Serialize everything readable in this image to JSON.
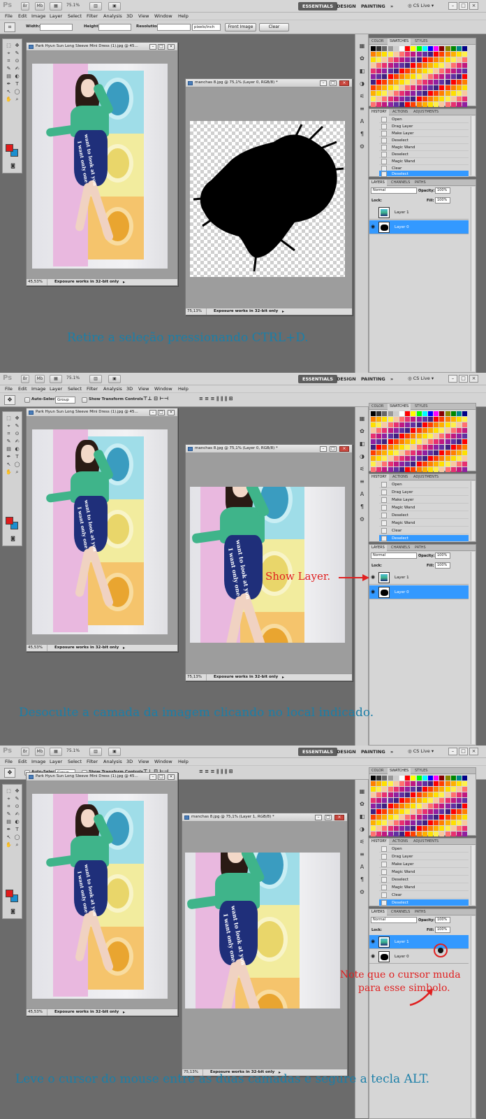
{
  "app": {
    "logo": "Ps",
    "mini_bridge_label": "Br",
    "mini_mb_label": "Mb",
    "zoom": "75.1%",
    "workspaces": [
      "ESSENTIALS",
      "DESIGN",
      "PAINTING",
      "»"
    ],
    "cs_live": "CS Live",
    "menu": [
      "File",
      "Edit",
      "Image",
      "Layer",
      "Select",
      "Filter",
      "Analysis",
      "3D",
      "View",
      "Window",
      "Help"
    ],
    "window_controls": [
      "–",
      "□",
      "×"
    ]
  },
  "options_crop": {
    "width_label": "Width:",
    "height_label": "Height:",
    "resolution_label": "Resolution:",
    "resolution_unit": "pixels/inch",
    "front_image": "Front Image",
    "clear": "Clear"
  },
  "options_move": {
    "auto_select_label": "Auto-Select:",
    "auto_select_value": "Group",
    "show_transform": "Show Transform Controls"
  },
  "doc_left": {
    "title": "Park Hyun Sun Long Sleeve Mini Dress (1).jpg @ 45...",
    "zoom": "45,53%",
    "status": "Exposure works in 32-bit only"
  },
  "doc_manchas": {
    "title_1": "manchas 8.jpg @ 75,1% (Layer 0, RGB/8) *",
    "title_2": "manchas 8.jpg @ 75,1% (Layer 0, RGB/8) *",
    "title_3": "manchas 8.jpg @ 75,1% (Layer 1, RGB/8) *",
    "zoom": "75,13%",
    "status": "Exposure works in 32-bit only"
  },
  "dress_text": [
    "want to look at you",
    "I want only one"
  ],
  "panels": {
    "color_tabs": [
      "COLOR",
      "SWATCHES",
      "STYLES"
    ],
    "history_tabs": [
      "HISTORY",
      "ACTIONS",
      "ADJUSTMENTS"
    ],
    "history_items_1": [
      "Open",
      "Drag Layer",
      "Make Layer",
      "Deselect",
      "Magic Wand",
      "Deselect",
      "Magic Wand",
      "Clear",
      "Deselect"
    ],
    "history_items_2": [
      "Open",
      "Drag Layer",
      "Make Layer",
      "Magic Wand",
      "Deselect",
      "Magic Wand",
      "Clear",
      "Deselect"
    ],
    "layers_tabs": [
      "LAYERS",
      "CHANNELS",
      "PATHS"
    ],
    "blend_mode": "Normal",
    "opacity_label": "Opacity:",
    "opacity_value": "100%",
    "lock_label": "Lock:",
    "fill_label": "Fill:",
    "fill_value": "100%",
    "layer_1": "Layer 1",
    "layer_0": "Layer 0"
  },
  "captions": {
    "step1": "Retire a seleção pressionando CTRL+D.",
    "step2": "Desoculte a camada da imagem clicando no local indicado.",
    "step3": "Leve o cursor do mouse entre as duas camadas e segure a tecla ALT.",
    "show_layer": "Show Layer.",
    "note_line1": "Note que o cursor muda",
    "note_line2": "para esse simbolo."
  },
  "colors": {
    "caption_blue": "#1b7fa8",
    "annotation_red": "#e02020",
    "selection_blue": "#3399ff",
    "foreground_red": "#e11b1b",
    "background_blue": "#1b8fd0"
  }
}
